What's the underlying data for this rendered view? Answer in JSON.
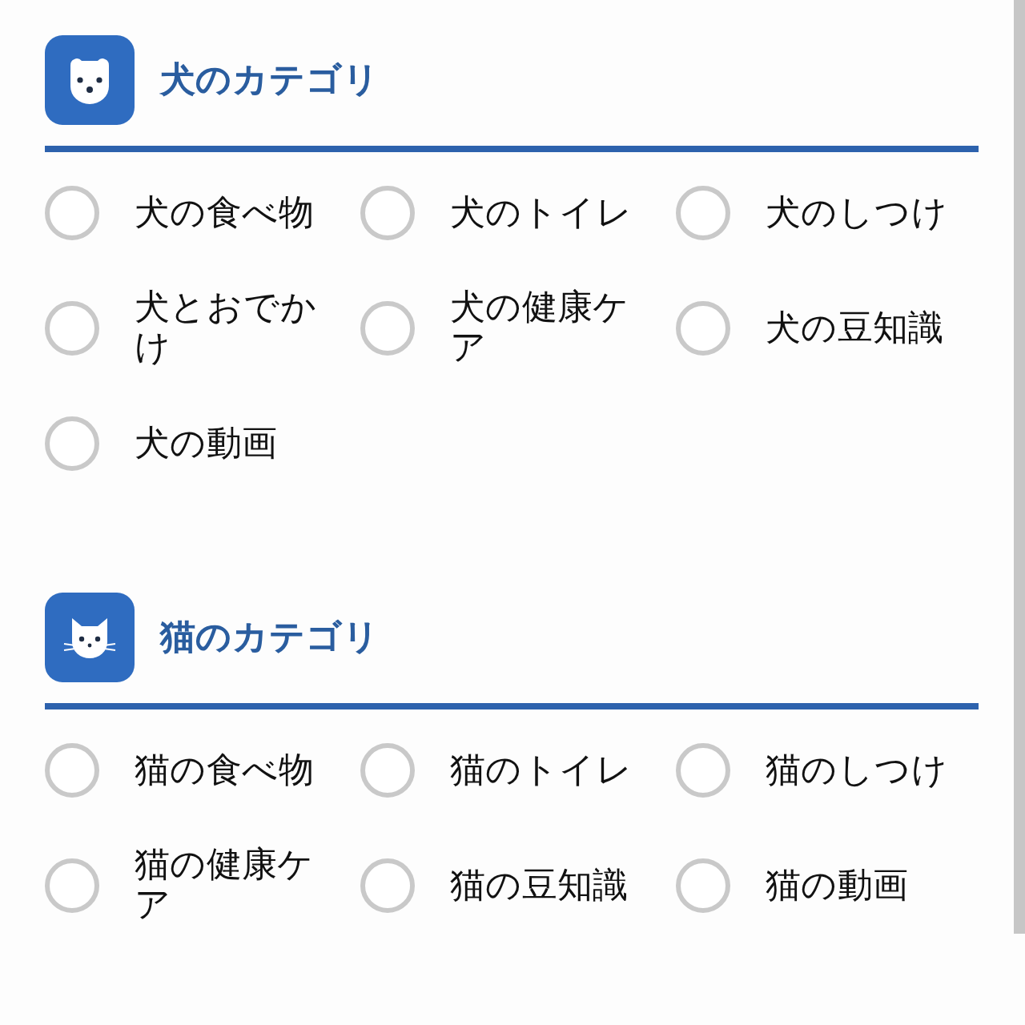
{
  "sections": [
    {
      "kind": "dog",
      "title": "犬のカテゴリ",
      "options": [
        {
          "label": "犬の食べ物",
          "selected": false
        },
        {
          "label": "犬のトイレ",
          "selected": false
        },
        {
          "label": "犬のしつけ",
          "selected": false
        },
        {
          "label": "犬とおでかけ",
          "selected": false
        },
        {
          "label": "犬の健康ケア",
          "selected": false
        },
        {
          "label": "犬の豆知識",
          "selected": false
        },
        {
          "label": "犬の動画",
          "selected": false
        }
      ]
    },
    {
      "kind": "cat",
      "title": "猫のカテゴリ",
      "options": [
        {
          "label": "猫の食べ物",
          "selected": false
        },
        {
          "label": "猫のトイレ",
          "selected": false
        },
        {
          "label": "猫のしつけ",
          "selected": false
        },
        {
          "label": "猫の健康ケア",
          "selected": false
        },
        {
          "label": "猫の豆知識",
          "selected": false
        },
        {
          "label": "猫の動画",
          "selected": false
        }
      ]
    }
  ]
}
